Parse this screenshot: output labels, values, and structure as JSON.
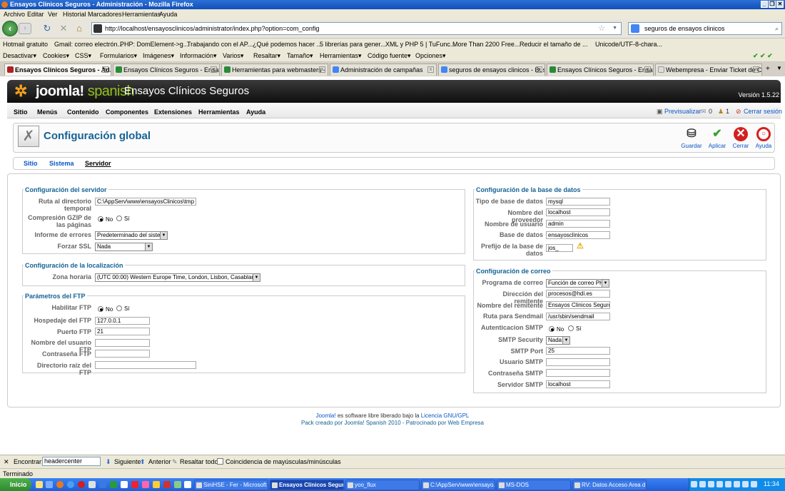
{
  "window": {
    "title": "Ensayos Clínicos Seguros - Administración - Mozilla Firefox"
  },
  "menubar": [
    "Archivo",
    "Editar",
    "Ver",
    "Historial",
    "Marcadores",
    "Herramientas",
    "Ayuda"
  ],
  "navbar": {
    "url": "http://localhost/ensayosclinicos/administrator/index.php?option=com_config",
    "search": "seguros de ensayos clinicos"
  },
  "bookmarks": [
    "Hotmail gratuito",
    "Gmail: correo electrón...",
    "PHP: DomElement->g...",
    "Trabajando con el AP...",
    "¿Qué podemos hacer ...",
    "5 librerías para gener...",
    "XML y PHP 5 | TuFunc...",
    "More Than 2200 Free...",
    "Reducir el tamaño de ...",
    "Unicode/UTF-8-chara..."
  ],
  "toolbar2": [
    "Desactivar▾",
    "Cookies▾",
    "CSS▾",
    "Formularios▾",
    "Imágenes▾",
    "Información▾",
    "Varios▾",
    "Resaltar▾",
    "Tamaño▾",
    "Herramientas▾",
    "Código fuente▾",
    "Opciones▾"
  ],
  "tabs": [
    "Ensayos Clínicos Seguros - Ad...",
    "Ensayos Clínicos Seguros - Ensayos...",
    "Herramientas para webmasters - P...",
    "Administración de campañas",
    "seguros de ensayos clinicos - Busca...",
    "Ensayos Clínicos Seguros - Ensayos...",
    "Webempresa - Enviar Ticket de Co..."
  ],
  "joomla": {
    "logo_a": "joomla!",
    "logo_b": "spanish",
    "site_name": "Ensayos Clínicos Seguros",
    "version": "Versión 1.5.22",
    "menu": [
      "Sitio",
      "Menús",
      "Contenido",
      "Componentes",
      "Extensiones",
      "Herramientas",
      "Ayuda"
    ],
    "right": {
      "preview": "Previsualizar",
      "messages": "0",
      "users": "1",
      "logout": "Cerrar sesión"
    },
    "page_title": "Configuración global",
    "toolbar": [
      "Guardar",
      "Aplicar",
      "Cerrar",
      "Ayuda"
    ],
    "subtabs": [
      "Sitio",
      "Sistema",
      "Servidor"
    ]
  },
  "server": {
    "legend": "Configuración del servidor",
    "tmp_label": "Ruta al directorio temporal",
    "tmp_value": "C:\\AppServ\\www\\ensayosClinicos\\tmp",
    "gzip_label": "Compresión GZIP de las páginas",
    "errors_label": "Informe de errores",
    "errors_value": "Predeterminado del sistema",
    "ssl_label": "Forzar SSL",
    "ssl_value": "Nada"
  },
  "radio": {
    "no": "No",
    "yes": "Sí"
  },
  "locale": {
    "legend": "Configuración de la localización",
    "tz_label": "Zona horaria",
    "tz_value": "(UTC 00:00) Western Europe Time, London, Lisbon, Casablanca"
  },
  "ftp": {
    "legend": "Parámetros del FTP",
    "enable_label": "Habilitar FTP",
    "host_label": "Hospedaje del FTP",
    "host_value": "127.0.0.1",
    "port_label": "Puerto FTP",
    "port_value": "21",
    "user_label": "Nombre del usuario FTP",
    "user_value": "",
    "pass_label": "Contraseña FTP",
    "pass_value": "",
    "root_label": "Directorio raíz del FTP",
    "root_value": ""
  },
  "db": {
    "legend": "Configuración de la base de datos",
    "type_label": "Tipo de base de datos",
    "type_value": "mysql",
    "host_label": "Nombre del proveedor",
    "host_value": "localhost",
    "user_label": "Nombre de usuario",
    "user_value": "admin",
    "name_label": "Base de datos",
    "name_value": "ensayosclinicos",
    "prefix_label": "Prefijo de la base de datos",
    "prefix_value": "jos_"
  },
  "mail": {
    "legend": "Configuración de correo",
    "mailer_label": "Programa de correo",
    "mailer_value": "Función de correo PHP",
    "from_label": "Dirección del remitente",
    "from_value": "procesos@hdi.es",
    "fromname_label": "Nombre del remitente",
    "fromname_value": "Ensayos Clinicos Seguros",
    "sendmail_label": "Ruta para Sendmail",
    "sendmail_value": "/usr/sbin/sendmail",
    "smtpauth_label": "Autenticacion SMTP",
    "smtpsec_label": "SMTP Security",
    "smtpsec_value": "Nada",
    "smtpport_label": "SMTP Port",
    "smtpport_value": "25",
    "smtpuser_label": "Usuario SMTP",
    "smtpuser_value": "",
    "smtppass_label": "Contraseña SMTP",
    "smtppass_value": "",
    "smtphost_label": "Servidor SMTP",
    "smtphost_value": "localhost"
  },
  "footer": {
    "line1_a": "Joomla!",
    "line1_b": " es software libre liberado bajo la ",
    "line1_c": "Licencia GNU/GPL",
    "line2": "Pack creado por Joomla! Spanish 2010 - Patrocinado por Web Empresa"
  },
  "findbar": {
    "label": "Encontrar:",
    "value": "headercenter",
    "next": "Siguiente",
    "prev": "Anterior",
    "highlight": "Resaltar todo",
    "matchcase": "Coincidencia de mayúsculas/minúsculas"
  },
  "status": "Terminado",
  "taskbar": {
    "start": "Inicio",
    "items": [
      "SiniHSE - Fer - Microsoft ...",
      "Ensayos Clínicos Segur...",
      "yoo_flux",
      "C:\\AppServ\\www\\ensayo...",
      "MS-DOS",
      "RV: Datos Acceso Area d..."
    ],
    "clock": "11:34"
  }
}
